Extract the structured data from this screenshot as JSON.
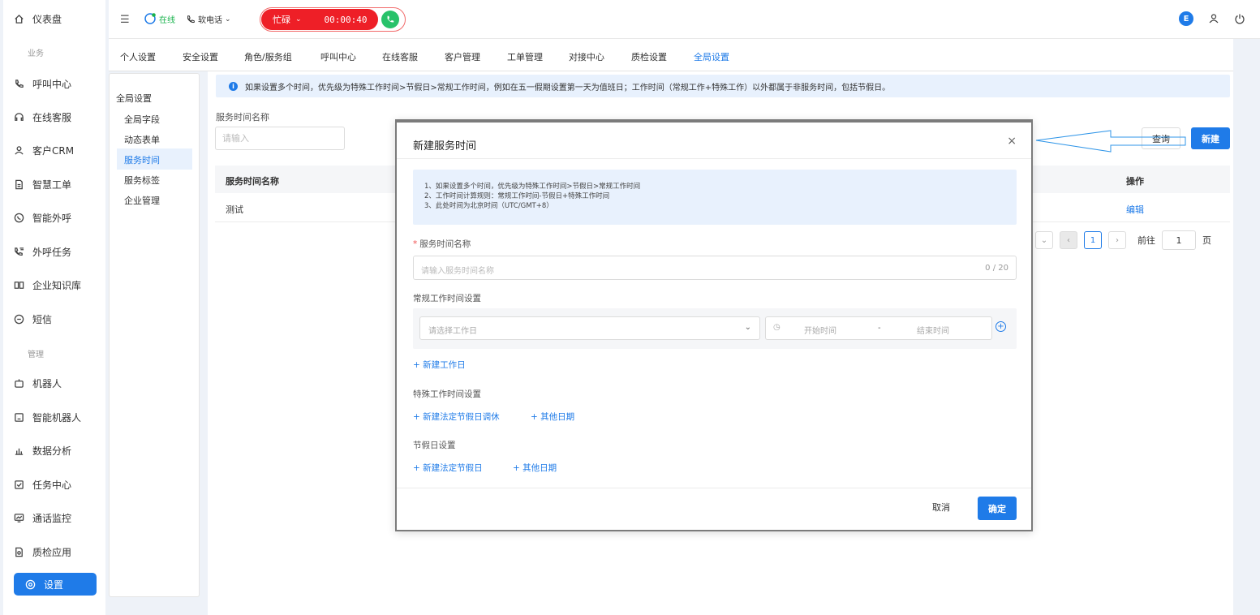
{
  "sidebar": {
    "items": [
      {
        "label": "仪表盘",
        "icon": "home-icon"
      },
      {
        "section": "业务"
      },
      {
        "label": "呼叫中心",
        "icon": "phone-icon"
      },
      {
        "label": "在线客服",
        "icon": "headset-icon"
      },
      {
        "label": "客户CRM",
        "icon": "user-icon"
      },
      {
        "label": "智慧工单",
        "icon": "document-icon"
      },
      {
        "label": "智能外呼",
        "icon": "whatsapp-icon"
      },
      {
        "label": "外呼任务",
        "icon": "phone-list-icon"
      },
      {
        "label": "企业知识库",
        "icon": "book-icon"
      },
      {
        "label": "短信",
        "icon": "sms-icon"
      },
      {
        "section": "管理"
      },
      {
        "label": "机器人",
        "icon": "robot-icon"
      },
      {
        "label": "智能机器人",
        "icon": "smart-robot-icon"
      },
      {
        "label": "数据分析",
        "icon": "chart-icon"
      },
      {
        "label": "任务中心",
        "icon": "task-icon"
      },
      {
        "label": "通话监控",
        "icon": "monitor-icon"
      },
      {
        "label": "质检应用",
        "icon": "inspection-icon"
      }
    ],
    "active": {
      "label": "设置",
      "icon": "settings-icon"
    }
  },
  "topbar": {
    "status": "在线",
    "phone": "软电话",
    "busy_label": "忙碌",
    "timer": "00:00:40",
    "avatar_letter": "E"
  },
  "tabs": [
    "个人设置",
    "安全设置",
    "角色/服务组",
    "呼叫中心",
    "在线客服",
    "客户管理",
    "工单管理",
    "对接中心",
    "质检设置",
    "全局设置"
  ],
  "active_tab": "全局设置",
  "subnav": {
    "head": "全局设置",
    "items": [
      "全局字段",
      "动态表单",
      "服务时间",
      "服务标签",
      "企业管理"
    ],
    "selected": "服务时间"
  },
  "main": {
    "banner": "如果设置多个时间，优先级为特殊工作时间>节假日>常规工作时间，例如在五一假期设置第一天为值班日；工作时间（常规工作+特殊工作）以外都属于非服务时间，包括节假日。",
    "search_label": "服务时间名称",
    "search_placeholder": "请输入",
    "query_btn": "查询",
    "new_btn": "新建",
    "columns": [
      "服务时间名称",
      "操作"
    ],
    "rows": [
      {
        "name": "测试",
        "action": "编辑"
      }
    ],
    "pager": {
      "current": "1",
      "goto_label": "前往",
      "goto_value": "1",
      "page_suffix": "页"
    }
  },
  "modal": {
    "title": "新建服务时间",
    "close": "×",
    "notes": [
      "1、如果设置多个时间，优先级为特殊工作时间>节假日>常规工作时间",
      "2、工作时间计算规则：常规工作时间-节假日+特殊工作时间",
      "3、此处时间为北京时间（UTC/GMT+8）"
    ],
    "name_label": "服务时间名称",
    "name_placeholder": "请输入服务时间名称",
    "name_count": "0 / 20",
    "regular_label": "常规工作时间设置",
    "workday_placeholder": "请选择工作日",
    "start_placeholder": "开始时间",
    "time_sep": "-",
    "end_placeholder": "结束时间",
    "add_workday": "+  新建工作日",
    "special_label": "特殊工作时间设置",
    "add_holiday_shift": "+  新建法定节假日调休",
    "add_other_date_1": "+  其他日期",
    "holiday_label": "节假日设置",
    "add_holiday": "+  新建法定节假日",
    "add_other_date_2": "+  其他日期",
    "cancel": "取消",
    "ok": "确定"
  }
}
